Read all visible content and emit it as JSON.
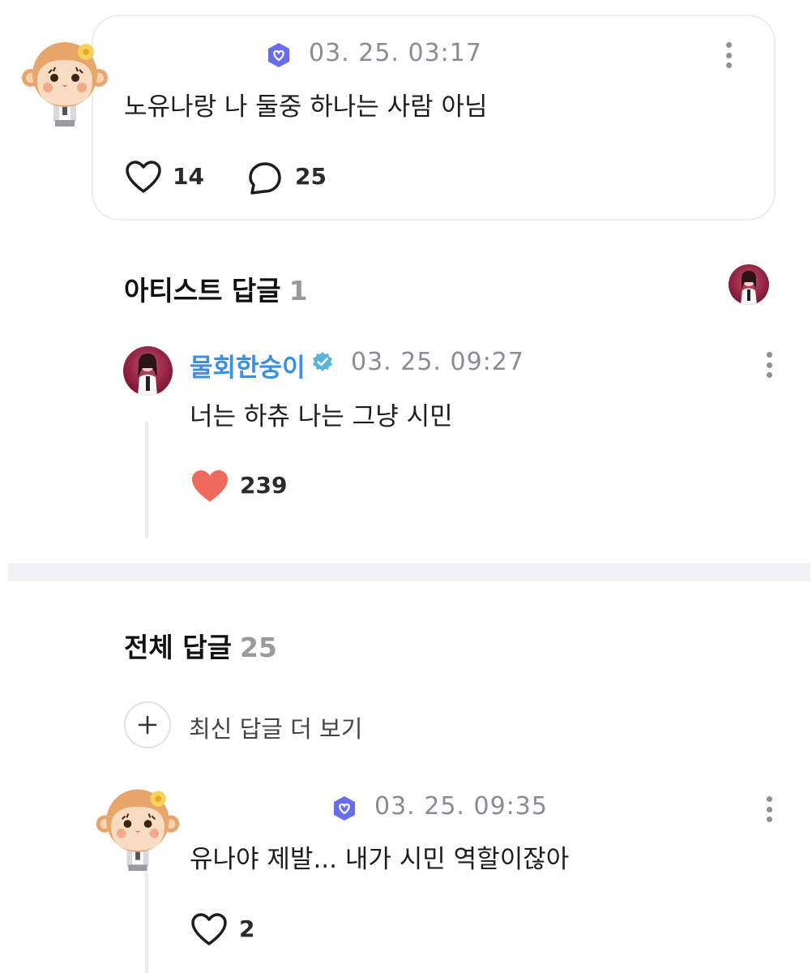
{
  "post": {
    "timestamp": "03. 25. 03:17",
    "text": "노유나랑 나 둘중 하나는 사람 아님",
    "likes": "14",
    "comments": "25"
  },
  "artist_section": {
    "title": "아티스트 답글",
    "count": "1"
  },
  "artist_reply": {
    "username": "물회한숭이",
    "timestamp": "03. 25. 09:27",
    "text": "너는 하츄 나는 그냥 시민",
    "likes": "239"
  },
  "all_section": {
    "title": "전체 답글",
    "count": "25",
    "more_label": "최신 답글 더 보기"
  },
  "reply": {
    "timestamp": "03. 25. 09:35",
    "text": "유나야 제발... 내가 시민 역할이잖아",
    "likes": "2"
  },
  "colors": {
    "accent_blue": "#3b8de8",
    "heart_red": "#ef6a5d",
    "badge_purple": "#6a6cf0"
  },
  "icons": [
    "monkey-avatar-icon",
    "fan-badge-icon",
    "heart-outline-icon",
    "comment-bubble-icon",
    "verified-badge-icon",
    "heart-filled-icon",
    "plus-icon",
    "kebab-menu-icon"
  ]
}
